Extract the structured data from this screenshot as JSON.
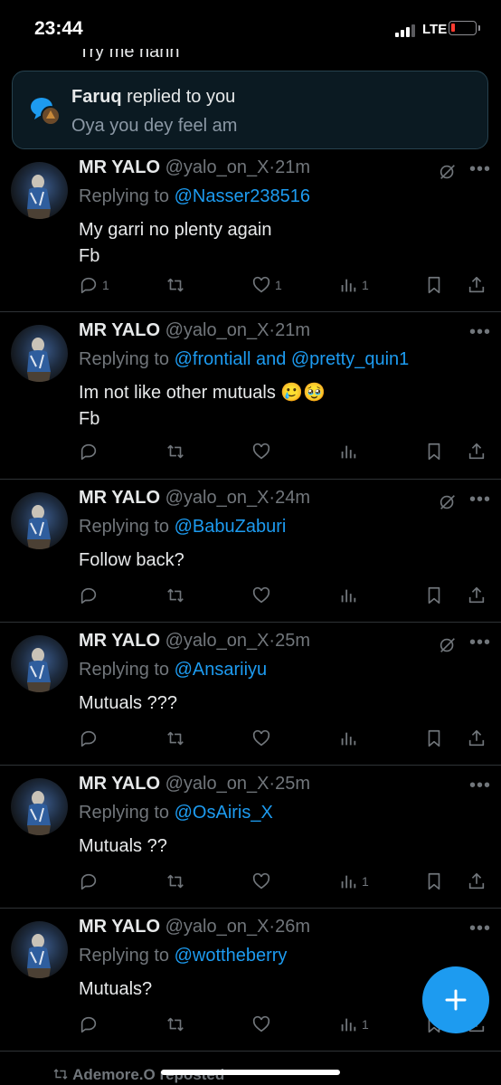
{
  "status": {
    "time": "23:44",
    "network": "LTE"
  },
  "cut_text": "Try me nahh",
  "toast": {
    "name": "Faruq",
    "action": " replied to you",
    "message": "Oya you dey feel am"
  },
  "tweets": [
    {
      "name": "MR YALO",
      "handle": "@yalo_on_X",
      "time": "21m",
      "replying_label": "Replying to ",
      "mentions": "@Nasser238516",
      "lines": [
        "My garri no plenty again",
        "Fb"
      ],
      "replies": "1",
      "reposts": "",
      "likes": "1",
      "views": "1",
      "grok": true
    },
    {
      "name": "MR YALO",
      "handle": "@yalo_on_X",
      "time": "21m",
      "replying_label": "Replying to ",
      "mentions": "@frontiall and @pretty_quin1",
      "lines": [
        "Im not like other mutuals 🥲🥹",
        "Fb"
      ],
      "replies": "",
      "reposts": "",
      "likes": "",
      "views": "",
      "grok": false
    },
    {
      "name": "MR YALO",
      "handle": "@yalo_on_X",
      "time": "24m",
      "replying_label": "Replying to ",
      "mentions": "@BabuZaburi",
      "lines": [
        "Follow back?"
      ],
      "replies": "",
      "reposts": "",
      "likes": "",
      "views": "",
      "grok": true
    },
    {
      "name": "MR YALO",
      "handle": "@yalo_on_X",
      "time": "25m",
      "replying_label": "Replying to ",
      "mentions": "@Ansariiyu",
      "lines": [
        "Mutuals ???"
      ],
      "replies": "",
      "reposts": "",
      "likes": "",
      "views": "",
      "grok": true
    },
    {
      "name": "MR YALO",
      "handle": "@yalo_on_X",
      "time": "25m",
      "replying_label": "Replying to ",
      "mentions": "@OsAiris_X",
      "lines": [
        "Mutuals ??"
      ],
      "replies": "",
      "reposts": "",
      "likes": "",
      "views": "1",
      "grok": false
    },
    {
      "name": "MR YALO",
      "handle": "@yalo_on_X",
      "time": "26m",
      "replying_label": "Replying to ",
      "mentions": "@wottheberry",
      "lines": [
        "Mutuals?"
      ],
      "replies": "",
      "reposts": "",
      "likes": "",
      "views": "1",
      "grok": false
    }
  ],
  "repost_line": "Ademore.O reposted",
  "colors": {
    "accent": "#1d9bf0",
    "muted": "#71767b",
    "text": "#e7e9ea",
    "background": "#000000"
  }
}
